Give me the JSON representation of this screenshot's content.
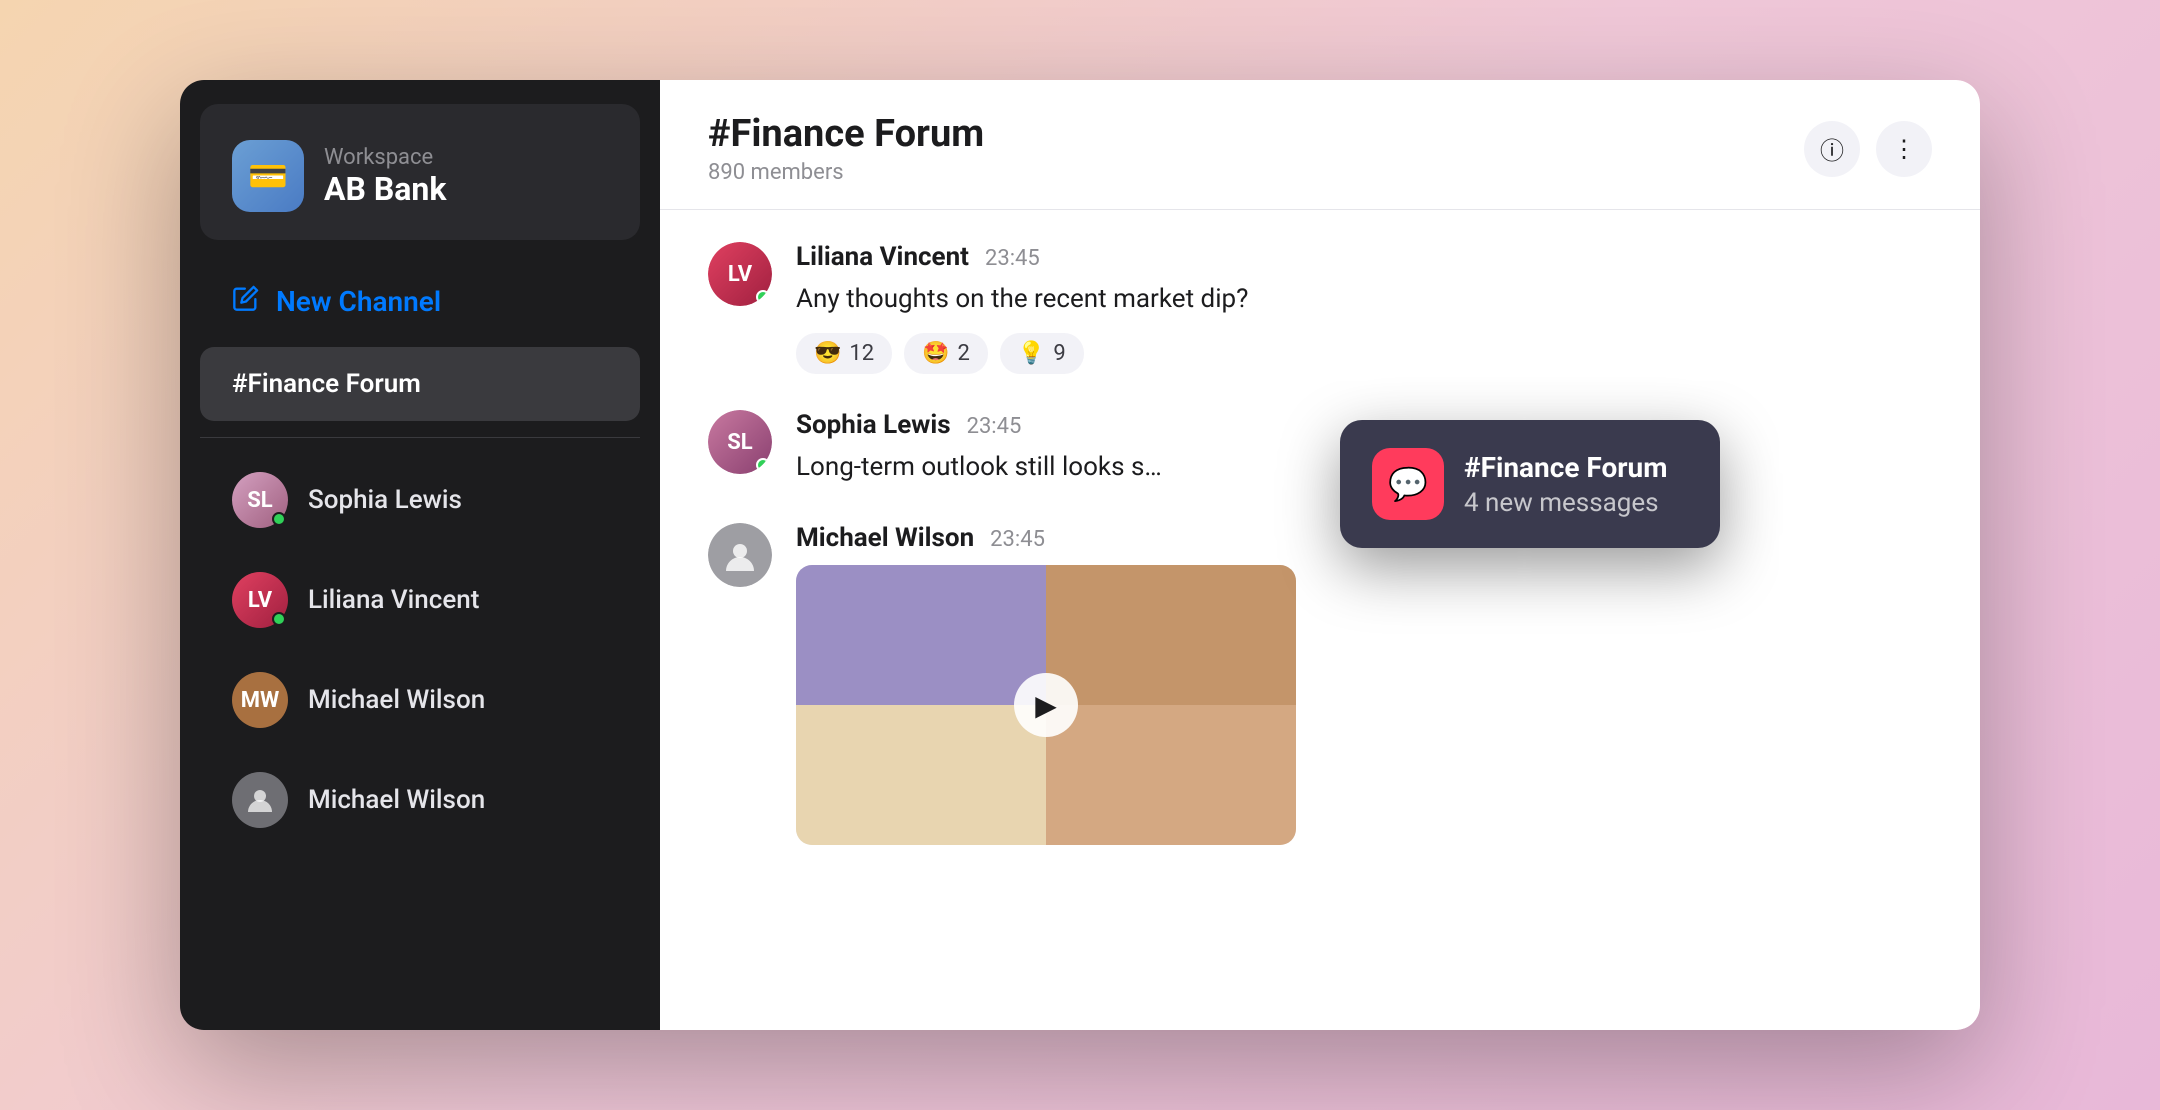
{
  "workspace": {
    "label": "Workspace",
    "name": "AB Bank",
    "avatar_emoji": "💳"
  },
  "sidebar": {
    "new_channel_label": "New Channel",
    "channel": "#Finance Forum",
    "dm_items": [
      {
        "name": "Sophia Lewis",
        "online": true,
        "color": "#c06090"
      },
      {
        "name": "Liliana Vincent",
        "online": true,
        "color": "#d04060"
      },
      {
        "name": "Michael Wilson",
        "online": false,
        "color": "#a87040"
      },
      {
        "name": "Michael Wilson",
        "online": false,
        "color": "#6e6e73"
      }
    ]
  },
  "chat": {
    "title": "#Finance Forum",
    "members": "890 members",
    "messages": [
      {
        "author": "Liliana Vincent",
        "time": "23:45",
        "text": "Any thoughts on the recent market dip?",
        "reactions": [
          {
            "emoji": "😎",
            "count": "12"
          },
          {
            "emoji": "🤩",
            "count": "2"
          },
          {
            "emoji": "💡",
            "count": "9"
          }
        ],
        "has_video": false,
        "online": true,
        "avatar_color": "#d04060"
      },
      {
        "author": "Sophia Lewis",
        "time": "23:45",
        "text": "Long-term outlook still looks s…",
        "reactions": [],
        "has_video": false,
        "online": true,
        "avatar_color": "#b06090"
      },
      {
        "author": "Michael Wilson",
        "time": "23:45",
        "text": "",
        "reactions": [],
        "has_video": true,
        "online": false,
        "avatar_color": "#9e9ea3"
      }
    ]
  },
  "notification": {
    "channel": "#Finance Forum",
    "message": "4 new messages",
    "icon": "💬"
  },
  "icons": {
    "info": "ⓘ",
    "more": "⋮",
    "edit": "✏",
    "play": "▶"
  }
}
